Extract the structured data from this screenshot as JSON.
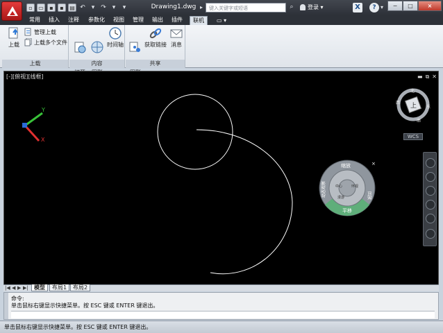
{
  "window": {
    "doc_title": "Drawing1.dwg",
    "search_placeholder": "键入关键字或短语",
    "login_label": "登录",
    "help_label": "?",
    "x_label": "X",
    "min_label": "−",
    "max_label": "□",
    "close_label": "×"
  },
  "qat": {
    "items": [
      "new",
      "open",
      "save",
      "save-as",
      "print",
      "undo",
      "redo"
    ]
  },
  "tabs": {
    "items": [
      {
        "label": "常用",
        "active": false
      },
      {
        "label": "插入",
        "active": false
      },
      {
        "label": "注释",
        "active": false
      },
      {
        "label": "参数化",
        "active": false
      },
      {
        "label": "视图",
        "active": false
      },
      {
        "label": "管理",
        "active": false
      },
      {
        "label": "输出",
        "active": false
      },
      {
        "label": "插件",
        "active": false
      },
      {
        "label": "联机",
        "active": true
      }
    ],
    "extra": "▭ ▾"
  },
  "ribbon": {
    "panels": [
      {
        "title": "上载",
        "buttons": [
          {
            "label": "上载",
            "icon": "upload-icon"
          }
        ],
        "small": [
          {
            "label": "管理上载",
            "icon": "manage-upload-icon"
          },
          {
            "label": "上载多个文件",
            "icon": "upload-multi-icon"
          }
        ]
      },
      {
        "title": "内容",
        "buttons": [
          {
            "label": "联机\n打开",
            "icon": "online-open-icon"
          },
          {
            "label": "联机\n图形",
            "icon": "online-drawing-icon"
          },
          {
            "label": "时间轴",
            "icon": "timeline-icon"
          }
        ]
      },
      {
        "title": "共享",
        "buttons": [
          {
            "label": "共享\n图形",
            "icon": "share-drawing-icon"
          },
          {
            "label": "获取链接",
            "icon": "get-link-icon"
          },
          {
            "label": "消息",
            "icon": "message-icon"
          }
        ]
      }
    ]
  },
  "viewport": {
    "label": "[-][俯视][线框]",
    "ctl_min": "▬",
    "ctl_restore": "⧉",
    "ctl_close": "✕",
    "ucs_x": "X",
    "ucs_y": "Y",
    "cube_top": "上",
    "cube_n": "北",
    "cube_s": "南",
    "cube_w": "西",
    "cube_e": "东",
    "wcs": "WCS",
    "wheel": {
      "zoom": "缩放",
      "orbit": "环视",
      "pan": "平移",
      "rewind": "回放",
      "center": "中心",
      "look": "动态观察",
      "walk": "漫游",
      "updown": "向上/向下",
      "close": "×"
    }
  },
  "layout_tabs": {
    "nav": [
      "|◀",
      "◀",
      "▶",
      "▶|"
    ],
    "items": [
      {
        "label": "模型",
        "active": true
      },
      {
        "label": "布局1",
        "active": false
      },
      {
        "label": "布局2",
        "active": false
      }
    ]
  },
  "command": {
    "line1": "命令:",
    "line2": "单击鼠标右键显示快捷菜单。按 ESC 键或 ENTER 键退出。"
  },
  "status": {
    "text": "单击鼠标右键显示快捷菜单。按 ESC 键或 ENTER 键退出。"
  },
  "colors": {
    "canvas": "#000000",
    "ucs_x": "#e03030",
    "ucs_y": "#39c239",
    "ucs_z": "#2a6ad9",
    "wheel_pan": "#5fae7a"
  }
}
